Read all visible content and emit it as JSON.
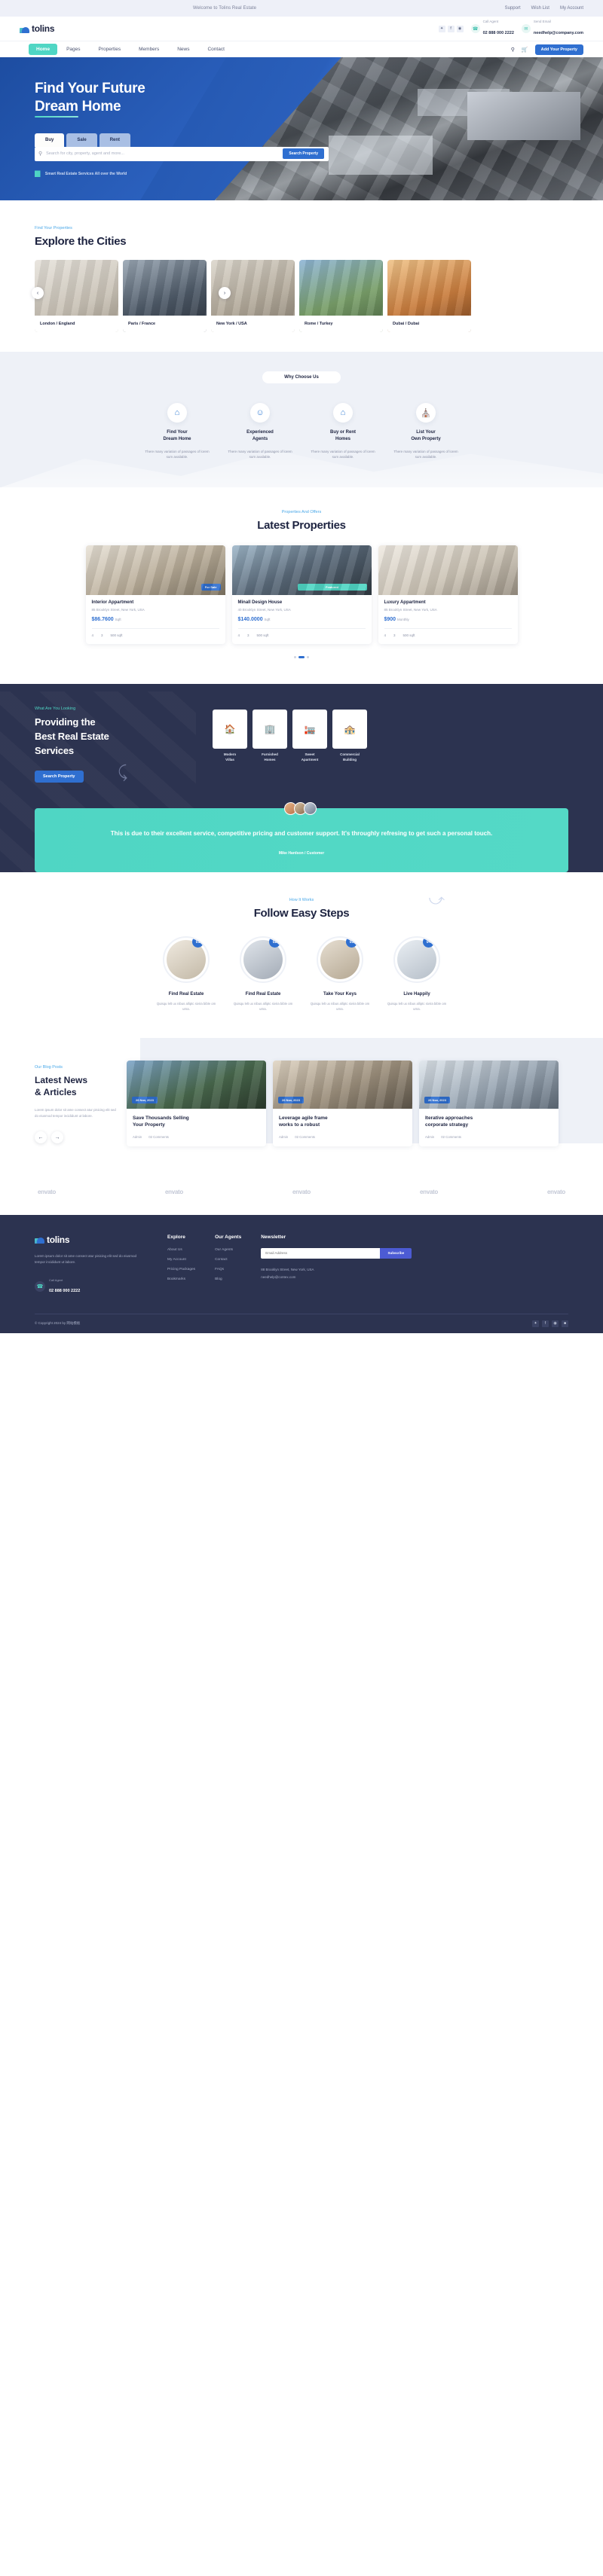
{
  "topbar": {
    "welcome": "Welcome to Tolins Real Estate",
    "links": [
      "Support",
      "Wish List",
      "My Account"
    ]
  },
  "brand": {
    "name": "tolins"
  },
  "header": {
    "social": [
      "twitter-icon",
      "facebook-icon",
      "instagram-icon"
    ],
    "call": {
      "label": "Call Agent",
      "value": "02 888 000 2222",
      "icon": "phone-icon"
    },
    "email": {
      "label": "Send Email",
      "value": "needhelp@company.com",
      "icon": "mail-icon"
    }
  },
  "nav": {
    "items": [
      "Home",
      "Pages",
      "Properties",
      "Members",
      "News",
      "Contact"
    ],
    "active": "Home",
    "search_icon": "search-icon",
    "cart_icon": "cart-icon",
    "cta": "Add Your Property"
  },
  "hero": {
    "title_line1": "Find Your Future",
    "title_underlined": "Dream",
    "title_line2_rest": " Home",
    "tabs": [
      "Buy",
      "Sale",
      "Rent"
    ],
    "active_tab": "Buy",
    "search_placeholder": "Search for city, property, agent and more...",
    "search_button": "Search Property",
    "note": "Smart Real Estate Services All over the World"
  },
  "cities": {
    "eyebrow": "Find Your Properties",
    "title": "Explore the Cities",
    "items": [
      {
        "label": "London / England"
      },
      {
        "label": "Paris / France"
      },
      {
        "label": "New York / USA"
      },
      {
        "label": "Rome / Turkey"
      },
      {
        "label": "Dubai / Dubai"
      }
    ]
  },
  "why": {
    "pill": "Why Choose Us",
    "features": [
      {
        "icon": "house-search-icon",
        "title": "Find Your\nDream Home",
        "desc": "There many variation of passages of lorem sum available."
      },
      {
        "icon": "agent-icon",
        "title": "Experienced\nAgents",
        "desc": "There many variation of passages of lorem sum available."
      },
      {
        "icon": "home-key-icon",
        "title": "Buy or Rent\nHomes",
        "desc": "There many variation of passages of lorem sum available."
      },
      {
        "icon": "list-property-icon",
        "title": "List Your\nOwn Property",
        "desc": "There many variation of passages of lorem sum available."
      }
    ]
  },
  "properties": {
    "eyebrow": "Properties And Offers",
    "title": "Latest Properties",
    "items": [
      {
        "name": "Interior Appartment",
        "address": "85 Brooklyn Street, New York, USA",
        "price": "$86.7600",
        "price_unit": "Sqft",
        "tag": "For Sale",
        "beds": "4",
        "baths": "3",
        "area": "500 sqft"
      },
      {
        "name": "Minall Design House",
        "address": "40 Brooklyn Street, New York, USA",
        "price": "$140.0000",
        "price_unit": "Sqft",
        "tag": "Featured",
        "beds": "4",
        "baths": "3",
        "area": "500 sqft"
      },
      {
        "name": "Luxury Appartment",
        "address": "85 Brooklyn Street, New York, USA",
        "price": "$900",
        "price_unit": "Monthly",
        "tag": "",
        "beds": "4",
        "baths": "3",
        "area": "500 sqft"
      }
    ]
  },
  "providing": {
    "eyebrow": "What Are You Looking",
    "title": "Providing the\nBest Real Estate\nServices",
    "button": "Search Property",
    "categories": [
      {
        "icon": "villa-icon",
        "label": "Modern\nVillas"
      },
      {
        "icon": "furnished-home-icon",
        "label": "Furnished\nHomes"
      },
      {
        "icon": "apartment-icon",
        "label": "Sweet\nApartment"
      },
      {
        "icon": "building-icon",
        "label": "Commercial\nBuilding"
      }
    ]
  },
  "testimonial": {
    "quote": "This is due to their excellent service, competitive pricing and customer support. It's throughly refresing to get such a personal touch.",
    "author": "Mike Hardson / Customer"
  },
  "steps": {
    "eyebrow": "How It Works",
    "title": "Follow Easy Steps",
    "items": [
      {
        "num": "01",
        "title": "Find Real Estate",
        "desc": "Quisqu lelt ux nibus alliptc sivira bible om urna."
      },
      {
        "num": "02",
        "title": "Find Real Estate",
        "desc": "Quisqu lelt ux nibus alliptc sivira bible om urna."
      },
      {
        "num": "03",
        "title": "Take Your Keys",
        "desc": "Quisqu lelt ux nibus alliptc sivira bible om urna."
      },
      {
        "num": "04",
        "title": "Live Happily",
        "desc": "Quisqu lelt ux nibus alliptc sivira bible om urna."
      }
    ]
  },
  "news": {
    "eyebrow": "Our Blog Posts",
    "title": "Latest News\n& Articles",
    "desc": "Lorem ipsum dolor sit ame consect atur pisicing elit sed do eiusmod tempor incididunt ut labore.",
    "prev_icon": "arrow-left-icon",
    "next_icon": "arrow-right-icon",
    "items": [
      {
        "date": "26 Nov, 2023",
        "title": "Save Thousands Selling\nYour Property",
        "author": "Admin",
        "comments": "02 Comments"
      },
      {
        "date": "26 Nov, 2023",
        "title": "Leverage agile frame\nworks to a robust",
        "author": "Admin",
        "comments": "02 Comments"
      },
      {
        "date": "26 Nov, 2023",
        "title": "Iterative approaches\ncorporate strategy",
        "author": "Admin",
        "comments": "02 Comments"
      }
    ]
  },
  "brands": [
    "envato",
    "envato",
    "envato",
    "envato",
    "envato"
  ],
  "footer": {
    "about": "Lorem ipsum dolor sit ame consect atur pisicing elit sed do eiusmod tempor incididunt ut labore.",
    "call": {
      "label": "Call Agent",
      "value": "02 888 000 2222",
      "icon": "phone-icon"
    },
    "explore": {
      "title": "Explore",
      "links": [
        "About Us",
        "My Account",
        "Pricing Packages",
        "Bookmarks"
      ]
    },
    "agents": {
      "title": "Our Agents",
      "links": [
        "Our Agents",
        "Contact",
        "FAQs",
        "Blog"
      ]
    },
    "newsletter": {
      "title": "Newsletter",
      "placeholder": "Email Address",
      "button": "Subscribe",
      "address": "88 Brooklyn Street, New York, USA",
      "email": "needhelp@contex.com"
    },
    "copyright": "© Copyright 2024 by 网站模板",
    "social": [
      "twitter-icon",
      "facebook-icon",
      "instagram-icon",
      "grid-icon"
    ]
  }
}
